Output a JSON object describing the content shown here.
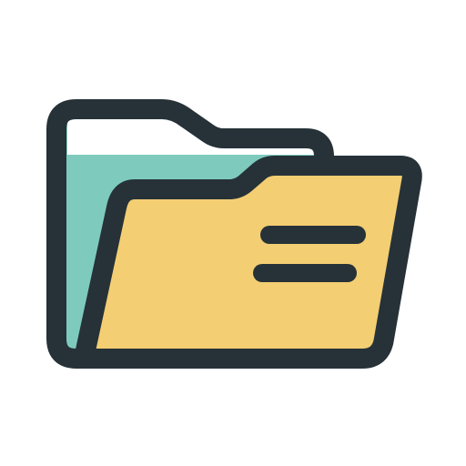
{
  "icon": {
    "name": "open-folder-icon",
    "colors": {
      "outline": "#263238",
      "back_panel": "#7ECBBE",
      "paper": "#FFFFFF",
      "front_panel": "#F4CE73",
      "background": "#FFFFFF"
    },
    "content_lines": 2
  }
}
